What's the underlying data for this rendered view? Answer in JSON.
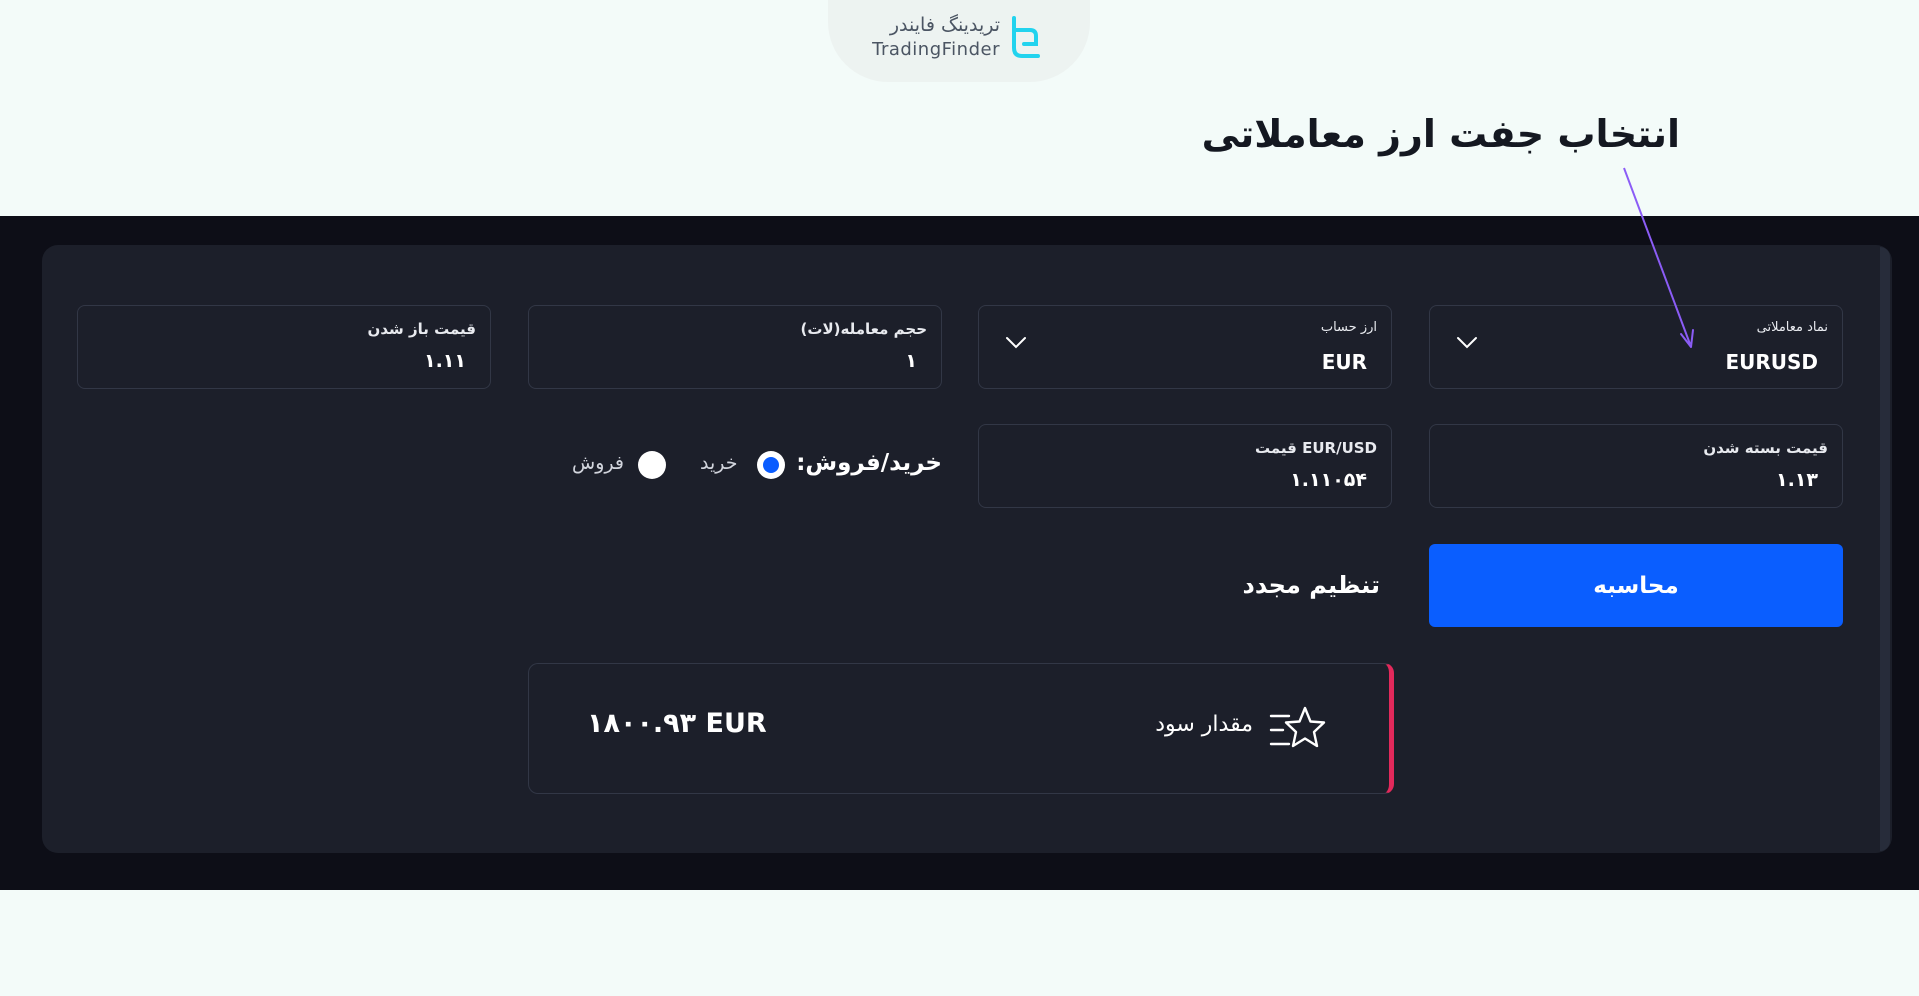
{
  "brand": {
    "name_fa": "تریدینگ فایندر",
    "name_en": "TradingFinder"
  },
  "annotation": {
    "text": "انتخاب جفت ارز معاملاتی"
  },
  "form": {
    "symbol": {
      "label": "نماد معاملاتی",
      "value": "EURUSD"
    },
    "account_currency": {
      "label": "ارز حساب",
      "value": "EUR"
    },
    "lot_size": {
      "label": "حجم معامله(لات)",
      "value": "۱"
    },
    "open_price": {
      "label": "قیمت باز شدن",
      "value": "۱.۱۱"
    },
    "close_price": {
      "label": "قیمت بسته شدن",
      "value": "۱.۱۳"
    },
    "pair_price": {
      "label": "EUR/USD قیمت",
      "value": "۱.۱۱۰۵۴"
    },
    "trade_type": {
      "label": "خرید/فروش:",
      "buy_label": "خرید",
      "sell_label": "فروش",
      "selected": "buy"
    }
  },
  "actions": {
    "calculate_label": "محاسبه",
    "reset_label": "تنظیم مجدد"
  },
  "result": {
    "label": "مقدار سود",
    "value": "۱۸۰۰.۹۳ EUR",
    "icon": "star-icon"
  },
  "colors": {
    "accent": "#0a5eff",
    "result_border": "#e2295b",
    "panel": "#1c1f2a",
    "band": "#0d0e17",
    "arrow": "#8b5cf6",
    "logo": "#22d3ee"
  }
}
